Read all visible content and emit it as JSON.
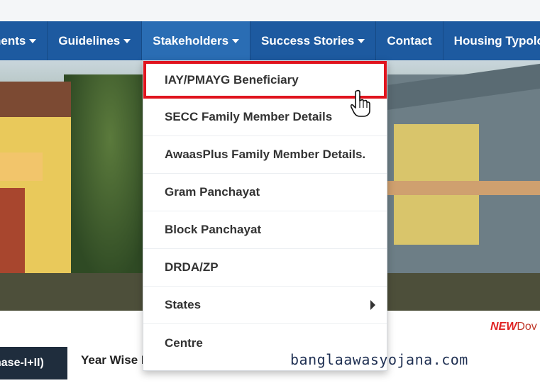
{
  "navbar": {
    "items": [
      {
        "label": "nents",
        "has_caret": true
      },
      {
        "label": "Guidelines",
        "has_caret": true
      },
      {
        "label": "Stakeholders",
        "has_caret": true,
        "active": true
      },
      {
        "label": "Success Stories",
        "has_caret": true
      },
      {
        "label": "Contact",
        "has_caret": false
      },
      {
        "label": "Housing Typologi",
        "has_caret": false
      }
    ]
  },
  "dropdown": {
    "items": [
      {
        "label": "IAY/PMAYG Beneficiary",
        "highlighted": true
      },
      {
        "label": "SECC Family Member Details"
      },
      {
        "label": "AwaasPlus Family Member Details."
      },
      {
        "label": "Gram Panchayat"
      },
      {
        "label": "Block Panchayat"
      },
      {
        "label": "DRDA/ZP"
      },
      {
        "label": "States",
        "has_submenu": true
      },
      {
        "label": "Centre"
      }
    ]
  },
  "below": {
    "new_badge": "NEW",
    "new_text": "Dov"
  },
  "tabs": {
    "dark_label": "hase-I+II)",
    "light_label": "Year Wise P"
  },
  "watermark": "banglaawasyojana.com",
  "colors": {
    "navbar_bg": "#1d5aa0",
    "highlight_border": "#e0141e",
    "tab_dark_bg": "#1f2d3d"
  },
  "icons": {
    "nav_caret": "caret-down-icon",
    "submenu": "chevron-right-icon",
    "pointer": "hand-pointer-cursor-icon"
  }
}
